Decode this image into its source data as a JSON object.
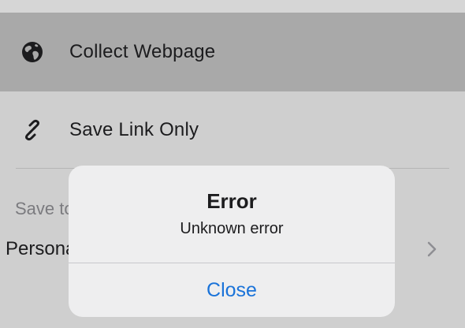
{
  "menu": {
    "items": [
      {
        "label": "Collect Webpage",
        "icon": "globe-icon"
      },
      {
        "label": "Save Link Only",
        "icon": "link-icon"
      }
    ]
  },
  "save_to": {
    "section_label": "Save to",
    "folder_label": "Personal",
    "chevron_icon": "chevron-right-icon"
  },
  "alert": {
    "title": "Error",
    "message": "Unknown error",
    "button_label": "Close"
  },
  "colors": {
    "highlight_row": "#a9a9a9",
    "background": "#cfcfcf",
    "alert_background": "#eeeeef",
    "accent": "#1a73d9"
  }
}
